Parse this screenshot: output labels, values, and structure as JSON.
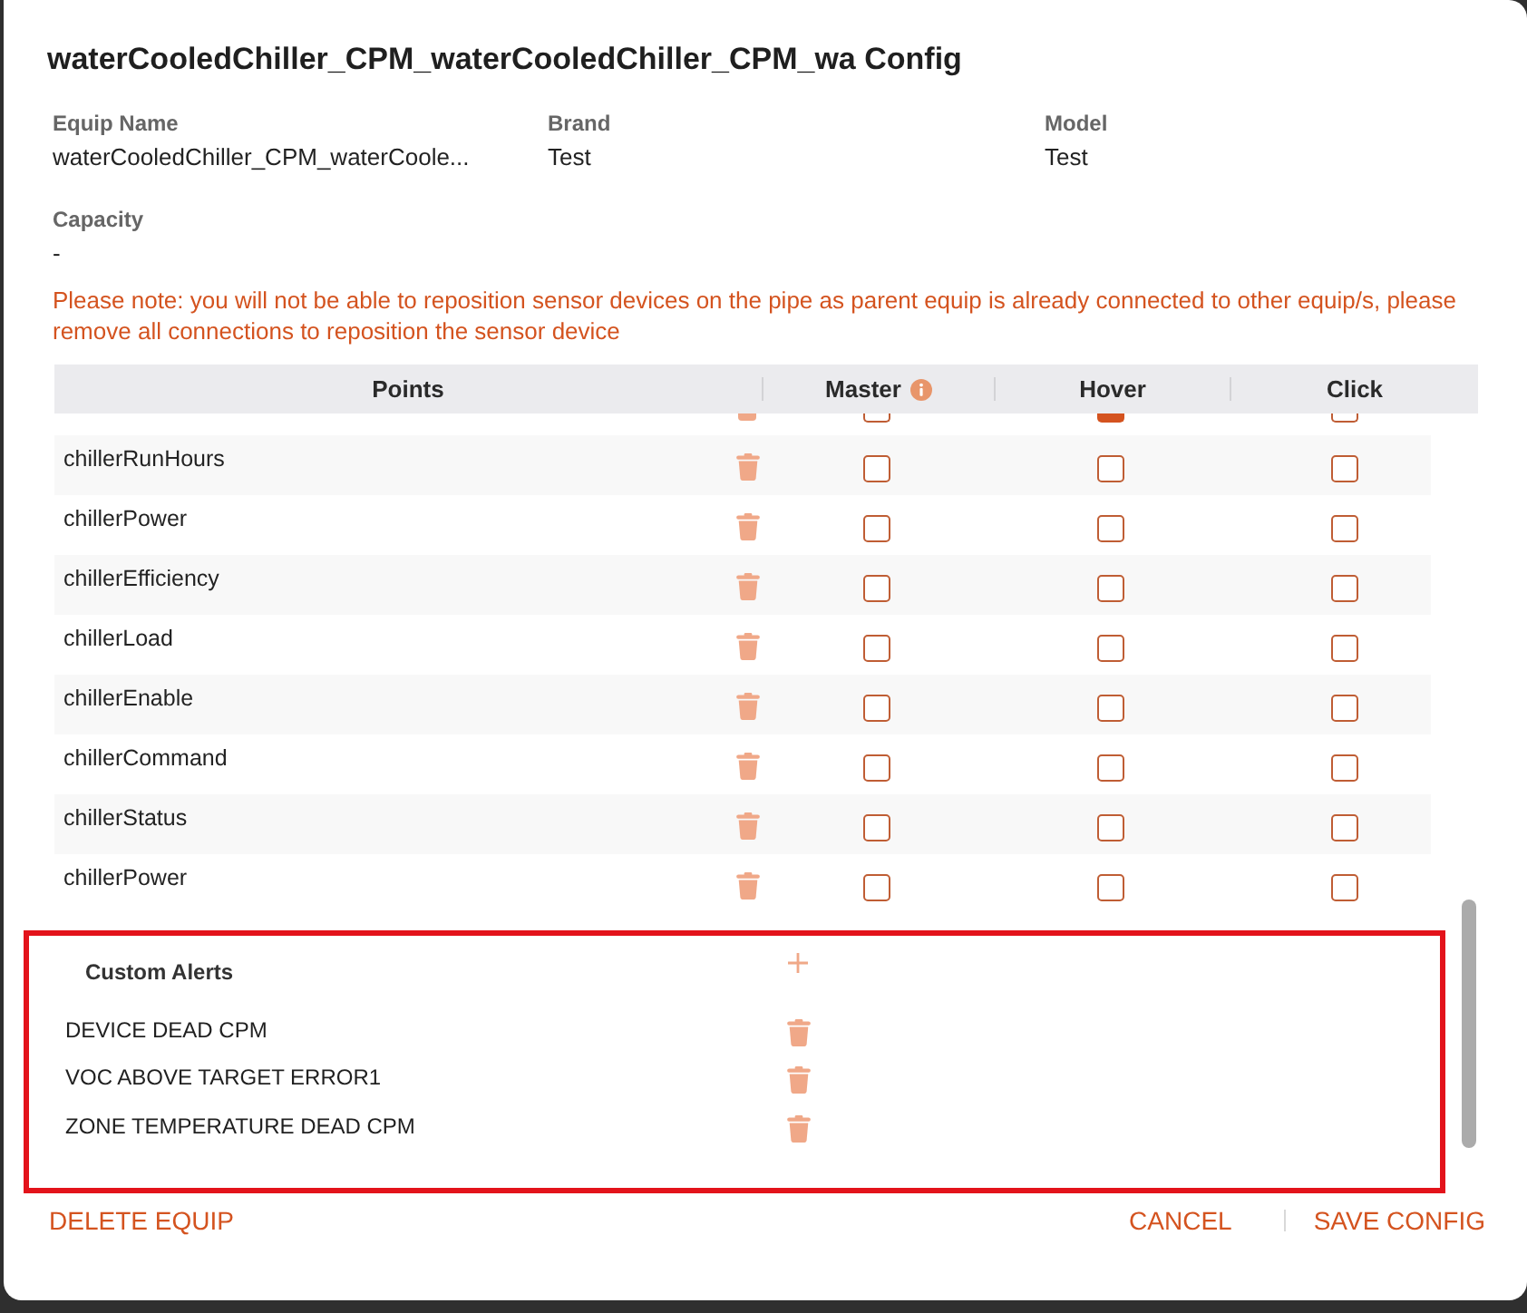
{
  "dialog": {
    "title": "waterCooledChiller_CPM_waterCooledChiller_CPM_wa Config"
  },
  "details": [
    {
      "label": "Equip Name",
      "value": "waterCooledChiller_CPM_waterCoole..."
    },
    {
      "label": "Brand",
      "value": "Test"
    },
    {
      "label": "Model",
      "value": "Test"
    },
    {
      "label": "Capacity",
      "value": "-"
    }
  ],
  "note": "Please note: you will not be able to reposition sensor devices on the pipe as parent equip is already connected to other equip/s, please remove all connections to reposition the sensor device",
  "points_table": {
    "columns": [
      {
        "label": "Points",
        "info": false
      },
      {
        "label": "Master",
        "info": true
      },
      {
        "label": "Hover",
        "info": false
      },
      {
        "label": "Click",
        "info": false
      }
    ],
    "rows": [
      {
        "kind": "partial",
        "master": false,
        "hover": true,
        "click": false
      },
      {
        "kind": "full",
        "name": "chillerRunHours",
        "master": false,
        "hover": false,
        "click": false
      },
      {
        "kind": "full",
        "name": "chillerPower",
        "master": false,
        "hover": false,
        "click": false
      },
      {
        "kind": "full",
        "name": "chillerEfficiency",
        "master": false,
        "hover": false,
        "click": false
      },
      {
        "kind": "full",
        "name": "chillerLoad",
        "master": false,
        "hover": false,
        "click": false
      },
      {
        "kind": "full",
        "name": "chillerEnable",
        "master": false,
        "hover": false,
        "click": false
      },
      {
        "kind": "full",
        "name": "chillerCommand",
        "master": false,
        "hover": false,
        "click": false
      },
      {
        "kind": "full",
        "name": "chillerStatus",
        "master": false,
        "hover": false,
        "click": false
      },
      {
        "kind": "full",
        "name": "chillerPower",
        "master": false,
        "hover": false,
        "click": false
      }
    ]
  },
  "custom_alerts": {
    "title": "Custom Alerts",
    "items": [
      "DEVICE DEAD CPM",
      "VOC ABOVE TARGET ERROR1",
      "ZONE TEMPERATURE DEAD CPM"
    ]
  },
  "footer": {
    "left_button": "DELETE EQUIP",
    "right_buttons": [
      "CANCEL",
      "SAVE CONFIG"
    ]
  }
}
